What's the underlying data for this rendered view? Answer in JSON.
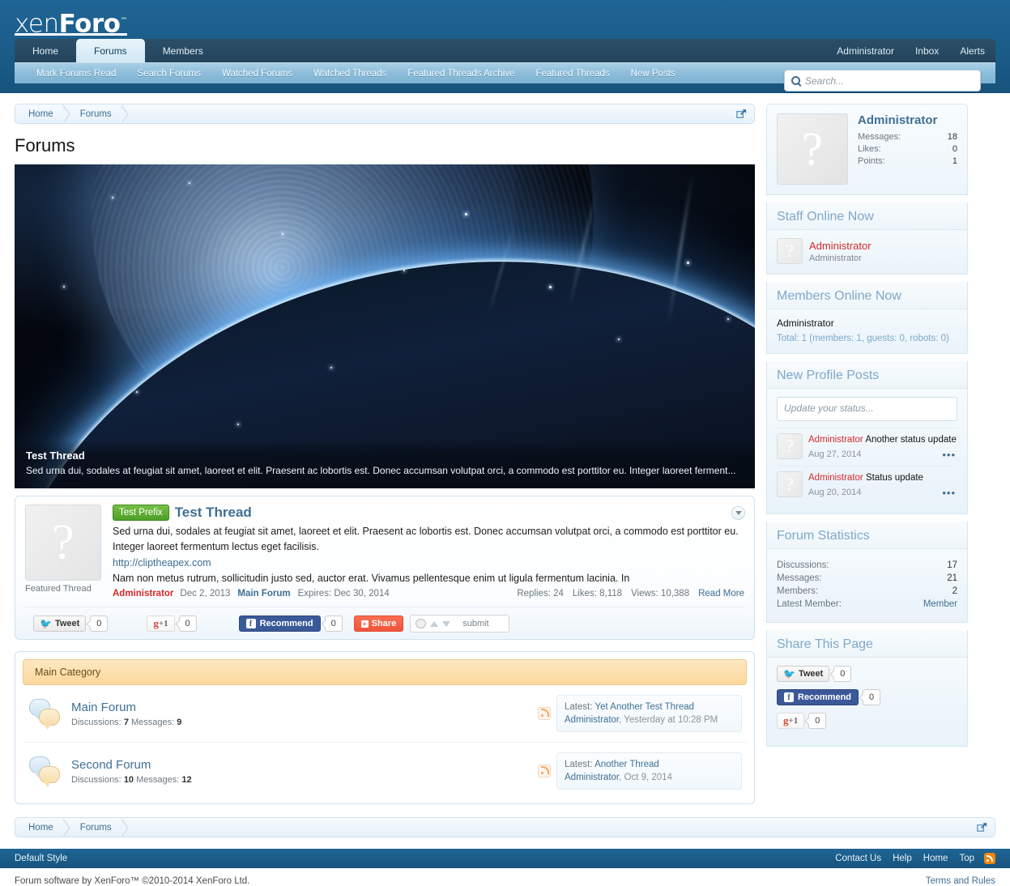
{
  "brand": {
    "name_part1": "xen",
    "name_part2": "Foro",
    "tm": "™"
  },
  "nav": {
    "tabs": [
      {
        "label": "Home",
        "selected": false
      },
      {
        "label": "Forums",
        "selected": true
      },
      {
        "label": "Members",
        "selected": false
      }
    ],
    "account": [
      {
        "label": "Administrator"
      },
      {
        "label": "Inbox"
      },
      {
        "label": "Alerts"
      }
    ],
    "subnav": [
      {
        "label": "Mark Forums Read"
      },
      {
        "label": "Search Forums"
      },
      {
        "label": "Watched Forums"
      },
      {
        "label": "Watched Threads"
      },
      {
        "label": "Featured Threads Archive"
      },
      {
        "label": "Featured Threads"
      },
      {
        "label": "New Posts"
      }
    ]
  },
  "search": {
    "placeholder": "Search...",
    "icon": "search-icon"
  },
  "breadcrumb": {
    "items": [
      {
        "label": "Home"
      },
      {
        "label": "Forums"
      }
    ],
    "external_icon": "open-in-new-window-icon"
  },
  "page": {
    "title": "Forums"
  },
  "hero": {
    "title": "Test Thread",
    "description": "Sed urna dui, sodales at feugiat sit amet, laoreet et elit. Praesent ac lobortis est. Donec accumsan volutpat orci, a commodo est porttitor eu. Integer laoreet ferment..."
  },
  "featured_thread": {
    "avatar_glyph": "?",
    "avatar_label": "Featured Thread",
    "prefix": "Test Prefix",
    "title": "Test Thread",
    "snippet": "Sed urna dui, sodales at feugiat sit amet, laoreet et elit. Praesent ac lobortis est. Donec accumsan volutpat orci, a commodo est porttitor eu. Integer laoreet fermentum lectus eget facilisis.",
    "link": "http://cliptheapex.com",
    "snippet2": "Nam non metus rutrum, sollicitudin justo sed, auctor erat. Vivamus pellentesque enim ut ligula fermentum lacinia. In",
    "author": "Administrator",
    "date": "Dec 2, 2013",
    "forum": "Main Forum",
    "expires": "Expires: Dec 30, 2014",
    "replies": "Replies: 24",
    "likes": "Likes: 8,118",
    "views": "Views: 10,388",
    "read_more": "Read More",
    "caret_icon": "chevron-down-icon"
  },
  "share_row": {
    "tweet_label": "Tweet",
    "tweet_count": "0",
    "gplus_label": "+1",
    "gplus_g": "g",
    "gplus_count": "0",
    "fb_label": "Recommend",
    "fb_count": "0",
    "share_label": "Share",
    "reddit_submit": "submit"
  },
  "nodes": {
    "category": "Main Category",
    "forums": [
      {
        "title": "Main Forum",
        "stats_label1": "Discussions:",
        "stats_value1": "7",
        "stats_label2": "Messages:",
        "stats_value2": "9",
        "last_prefix": "Latest:",
        "last_title": "Yet Another Test Thread",
        "last_user": "Administrator",
        "last_date": "Yesterday at 10:28 PM"
      },
      {
        "title": "Second Forum",
        "stats_label1": "Discussions:",
        "stats_value1": "10",
        "stats_label2": "Messages:",
        "stats_value2": "12",
        "last_prefix": "Latest:",
        "last_title": "Another Thread",
        "last_user": "Administrator",
        "last_date": "Oct 9, 2014"
      }
    ]
  },
  "sidebar": {
    "visitor": {
      "avatar_glyph": "?",
      "name": "Administrator",
      "stats": [
        {
          "label": "Messages:",
          "value": "18"
        },
        {
          "label": "Likes:",
          "value": "0"
        },
        {
          "label": "Points:",
          "value": "1"
        }
      ]
    },
    "staff_online": {
      "heading": "Staff Online Now",
      "members": [
        {
          "avatar_glyph": "?",
          "name": "Administrator",
          "title": "Administrator"
        }
      ]
    },
    "members_online": {
      "heading": "Members Online Now",
      "names": [
        "Administrator"
      ],
      "total": "Total: 1 (members: 1, guests: 0, robots: 0)"
    },
    "profile_posts": {
      "heading": "New Profile Posts",
      "input_placeholder": "Update your status...",
      "posts": [
        {
          "avatar_glyph": "?",
          "user": "Administrator",
          "text": "Another status update",
          "date": "Aug 27, 2014",
          "more": "•••"
        },
        {
          "avatar_glyph": "?",
          "user": "Administrator",
          "text": "Status update",
          "date": "Aug 20, 2014",
          "more": "•••"
        }
      ]
    },
    "forum_statistics": {
      "heading": "Forum Statistics",
      "rows": [
        {
          "label": "Discussions:",
          "value": "17",
          "is_link": false
        },
        {
          "label": "Messages:",
          "value": "21",
          "is_link": false
        },
        {
          "label": "Members:",
          "value": "2",
          "is_link": false
        },
        {
          "label": "Latest Member:",
          "value": "Member",
          "is_link": true
        }
      ]
    },
    "share_page": {
      "heading": "Share This Page",
      "tweet_label": "Tweet",
      "tweet_count": "0",
      "fb_label": "Recommend",
      "fb_count": "0",
      "gplus_g": "g",
      "gplus_label": "+1",
      "gplus_count": "0"
    }
  },
  "footer": {
    "breadcrumb": [
      {
        "label": "Home"
      },
      {
        "label": "Forums"
      }
    ],
    "style": "Default Style",
    "links": [
      {
        "label": "Contact Us"
      },
      {
        "label": "Help"
      },
      {
        "label": "Home"
      },
      {
        "label": "Top"
      }
    ],
    "rss_icon": "rss-icon",
    "copyright": "Forum software by XenForo™ ©2010-2014 XenForo Ltd.",
    "terms": "Terms and Rules"
  },
  "colors": {
    "header_blue": "#1b5c89",
    "link_blue": "#3f6f93",
    "accent_red": "#d42a2a",
    "category_orange": "#fbd79b",
    "prefix_green": "#4d9e28"
  }
}
